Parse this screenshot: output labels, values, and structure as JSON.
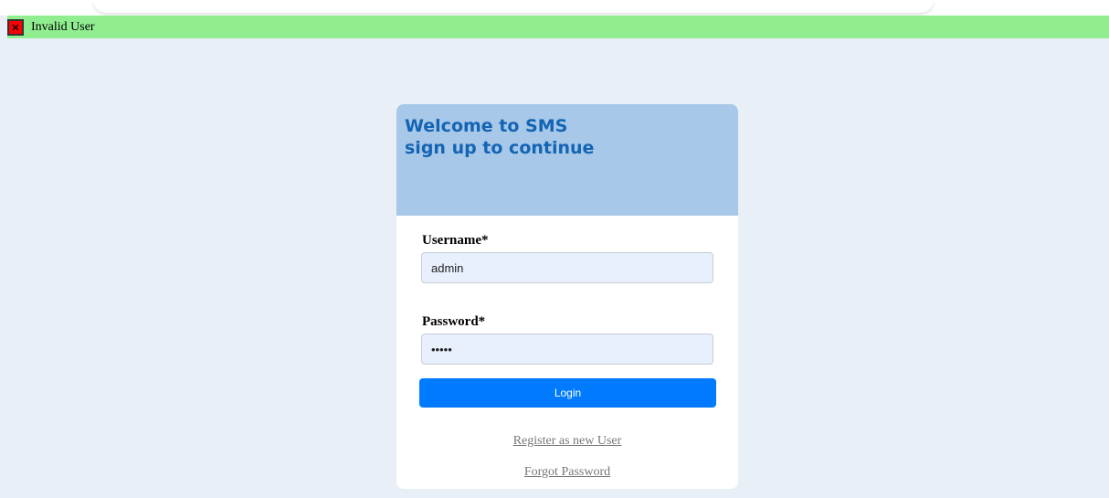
{
  "alert": {
    "icon": "close-icon",
    "message": "Invalid User",
    "color": "#90ee90"
  },
  "card": {
    "header_line1": "Welcome to SMS",
    "header_line2": "sign up to continue",
    "username_label": "Username*",
    "username_value": "admin",
    "password_label": "Password*",
    "password_value": "•••••",
    "login_label": "Login",
    "register_link": "Register as new User",
    "forgot_link": "Forgot Password"
  },
  "colors": {
    "page_bg": "#e8eff7",
    "header_bg": "#a7c8e8",
    "header_text": "#1464b4",
    "button": "#007bff"
  }
}
